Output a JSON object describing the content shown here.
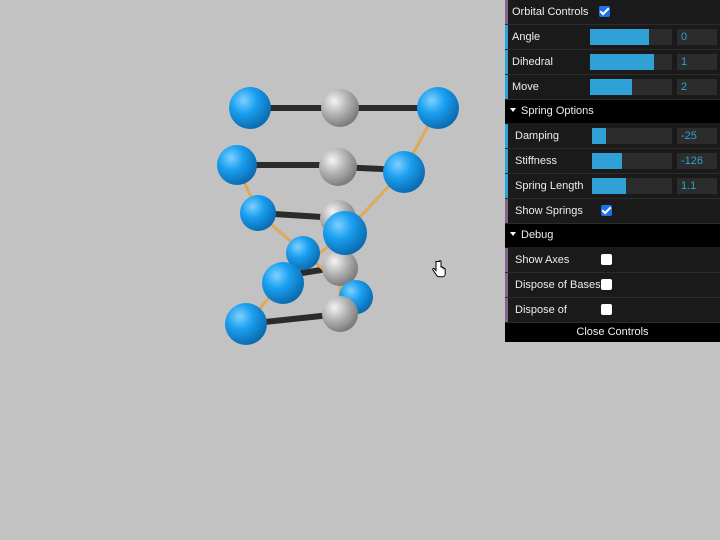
{
  "colors": {
    "background": "#c2c2c2",
    "panel": "#1a1a1a",
    "slider_fill": "#2fa1d6",
    "number_text": "#2fa1d6",
    "checkbox": "#1b73e8",
    "blue_atom": "#1a9ff0",
    "grey_atom": "#a8a8a8",
    "bond": "#2b2b2b",
    "spring": "#e0a85a",
    "accent_orbital": "#7a5c9a",
    "accent_number": "#2fa1d6",
    "accent_boolean": "#806787"
  },
  "gui": {
    "orbital": {
      "label": "Orbital Controls",
      "checked": true,
      "sliders": [
        {
          "label": "Angle",
          "value": "0",
          "fill": 0.72
        },
        {
          "label": "Dihedral",
          "value": "1",
          "fill": 0.78
        },
        {
          "label": "Move",
          "value": "2",
          "fill": 0.51
        }
      ]
    },
    "spring": {
      "folder_label": "Spring Options",
      "sliders": [
        {
          "label": "Damping",
          "value": "-25",
          "fill": 0.17
        },
        {
          "label": "Stiffness",
          "value": "-126",
          "fill": 0.37
        },
        {
          "label": "Spring Length",
          "value": "1.1",
          "fill": 0.42
        }
      ],
      "show_springs_label": "Show Springs",
      "show_springs_checked": true
    },
    "debug": {
      "folder_label": "Debug",
      "items": [
        {
          "label": "Show Axes",
          "checked": false
        },
        {
          "label": "Dispose of Bases",
          "checked": false
        },
        {
          "label": "Dispose of",
          "checked": false
        }
      ]
    },
    "close_label": "Close Controls"
  },
  "icons": {
    "cursor": "hand-pointer-icon",
    "folder_open": "triangle-down-icon",
    "checkbox": "checkmark-icon"
  }
}
